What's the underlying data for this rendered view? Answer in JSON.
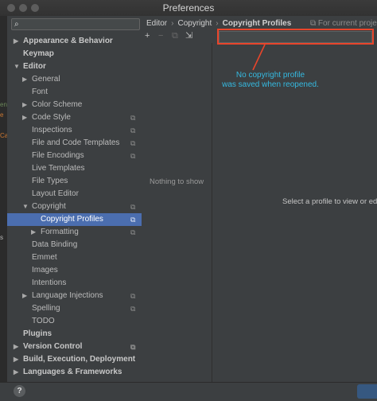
{
  "window": {
    "title": "Preferences"
  },
  "search": {
    "placeholder": ""
  },
  "left_strip": [
    "en",
    "e",
    "Ca",
    "s"
  ],
  "tree": [
    {
      "label": "Appearance & Behavior",
      "level": 0,
      "bold": true,
      "arrow": "right",
      "project_icon": false
    },
    {
      "label": "Keymap",
      "level": 0,
      "bold": true,
      "arrow": "none",
      "project_icon": false
    },
    {
      "label": "Editor",
      "level": 0,
      "bold": true,
      "arrow": "down",
      "project_icon": false
    },
    {
      "label": "General",
      "level": 1,
      "bold": false,
      "arrow": "right",
      "project_icon": false
    },
    {
      "label": "Font",
      "level": 1,
      "bold": false,
      "arrow": "none",
      "project_icon": false
    },
    {
      "label": "Color Scheme",
      "level": 1,
      "bold": false,
      "arrow": "right",
      "project_icon": false
    },
    {
      "label": "Code Style",
      "level": 1,
      "bold": false,
      "arrow": "right",
      "project_icon": true
    },
    {
      "label": "Inspections",
      "level": 1,
      "bold": false,
      "arrow": "none",
      "project_icon": true
    },
    {
      "label": "File and Code Templates",
      "level": 1,
      "bold": false,
      "arrow": "none",
      "project_icon": true
    },
    {
      "label": "File Encodings",
      "level": 1,
      "bold": false,
      "arrow": "none",
      "project_icon": true
    },
    {
      "label": "Live Templates",
      "level": 1,
      "bold": false,
      "arrow": "none",
      "project_icon": false
    },
    {
      "label": "File Types",
      "level": 1,
      "bold": false,
      "arrow": "none",
      "project_icon": false
    },
    {
      "label": "Layout Editor",
      "level": 1,
      "bold": false,
      "arrow": "none",
      "project_icon": false
    },
    {
      "label": "Copyright",
      "level": 1,
      "bold": false,
      "arrow": "down",
      "project_icon": true
    },
    {
      "label": "Copyright Profiles",
      "level": 2,
      "bold": false,
      "arrow": "none",
      "project_icon": true,
      "selected": true
    },
    {
      "label": "Formatting",
      "level": 2,
      "bold": false,
      "arrow": "right",
      "project_icon": true
    },
    {
      "label": "Data Binding",
      "level": 1,
      "bold": false,
      "arrow": "none",
      "project_icon": false
    },
    {
      "label": "Emmet",
      "level": 1,
      "bold": false,
      "arrow": "none",
      "project_icon": false
    },
    {
      "label": "Images",
      "level": 1,
      "bold": false,
      "arrow": "none",
      "project_icon": false
    },
    {
      "label": "Intentions",
      "level": 1,
      "bold": false,
      "arrow": "none",
      "project_icon": false
    },
    {
      "label": "Language Injections",
      "level": 1,
      "bold": false,
      "arrow": "right",
      "project_icon": true
    },
    {
      "label": "Spelling",
      "level": 1,
      "bold": false,
      "arrow": "none",
      "project_icon": true
    },
    {
      "label": "TODO",
      "level": 1,
      "bold": false,
      "arrow": "none",
      "project_icon": false
    },
    {
      "label": "Plugins",
      "level": 0,
      "bold": true,
      "arrow": "none",
      "project_icon": false
    },
    {
      "label": "Version Control",
      "level": 0,
      "bold": true,
      "arrow": "right",
      "project_icon": true
    },
    {
      "label": "Build, Execution, Deployment",
      "level": 0,
      "bold": true,
      "arrow": "right",
      "project_icon": false
    },
    {
      "label": "Languages & Frameworks",
      "level": 0,
      "bold": true,
      "arrow": "right",
      "project_icon": false
    }
  ],
  "breadcrumb": {
    "editor": "Editor",
    "copyright": "Copyright",
    "profiles": "Copyright Profiles"
  },
  "scope_note": {
    "icon": "project-icon",
    "label": "For current project"
  },
  "toolbar": {
    "add": "+",
    "remove": "−",
    "copy": "⧉",
    "import": "⇲"
  },
  "profile_list": {
    "empty_text": "Nothing to show"
  },
  "detail": {
    "empty_text": "Select a profile to view or edit"
  },
  "annotation": {
    "line1": "No copyright profile",
    "line2": "was saved when reopened."
  },
  "bottom": {
    "help": "?"
  },
  "colors": {
    "selection": "#4b6eaf",
    "annotation": "#35b9e0",
    "highlight_box": "#e8452b",
    "background": "#3c3f41"
  }
}
